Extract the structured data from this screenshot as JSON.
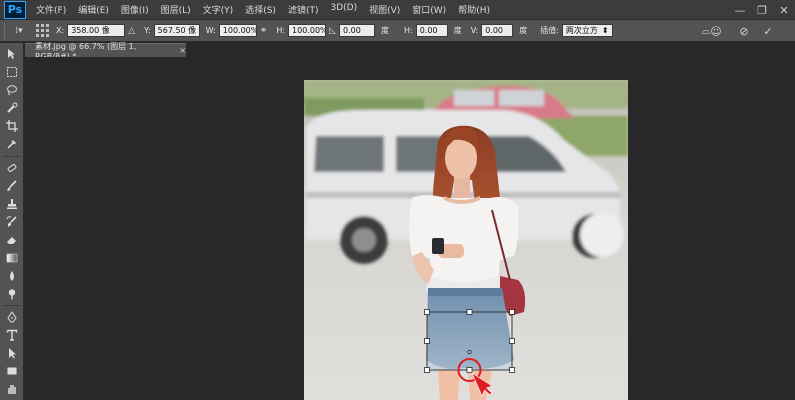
{
  "app": {
    "logo": "Ps"
  },
  "menu": [
    "文件(F)",
    "编辑(E)",
    "图像(I)",
    "图层(L)",
    "文字(Y)",
    "选择(S)",
    "滤镜(T)",
    "3D(D)",
    "视图(V)",
    "窗口(W)",
    "帮助(H)"
  ],
  "window_controls": {
    "minimize": "—",
    "restore": "❐",
    "close": "✕"
  },
  "options": {
    "x_label": "X:",
    "x_value": "358.00 像",
    "y_label": "Y:",
    "y_value": "567.50 像",
    "w_label": "W:",
    "w_value": "100.00%",
    "h_label": "H:",
    "h_value": "100.00%",
    "angle_value": "0.00",
    "angle_unit": "度",
    "hskew_label": "H:",
    "hskew_value": "0.00",
    "hskew_unit": "度",
    "vskew_label": "V:",
    "vskew_value": "0.00",
    "vskew_unit": "度",
    "interp_label": "插值:",
    "interp_value": "两次立方"
  },
  "document": {
    "tab_title": "素材.jpg @ 66.7% (图层 1, RGB/8#) *",
    "tab_close": "×"
  },
  "colors": {
    "menubar": "#3c3c3c",
    "panel": "#535353",
    "workspace": "#282828",
    "accent": "#31a8ff"
  }
}
